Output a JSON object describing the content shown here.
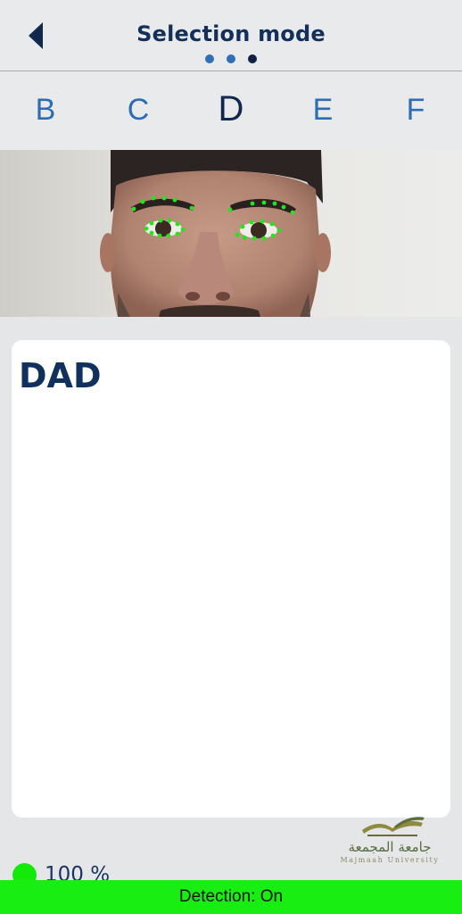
{
  "header": {
    "title": "Selection mode",
    "back_icon": "chevron-left-icon",
    "page_dots": {
      "count": 3,
      "active_index": 2
    }
  },
  "letters": [
    {
      "label": "B",
      "selected": false
    },
    {
      "label": "C",
      "selected": false
    },
    {
      "label": "D",
      "selected": true
    },
    {
      "label": "E",
      "selected": false
    },
    {
      "label": "F",
      "selected": false
    }
  ],
  "camera": {
    "landmark_color": "#1ee81a"
  },
  "composer": {
    "text": "DAD"
  },
  "logo": {
    "arabic": "جامعة المجمعة",
    "english": "Majmaah University"
  },
  "status": {
    "confidence_label": "100 %",
    "confidence_color": "#13ea09",
    "detection_label": "Detection: On",
    "detection_color": "#18ee11"
  }
}
